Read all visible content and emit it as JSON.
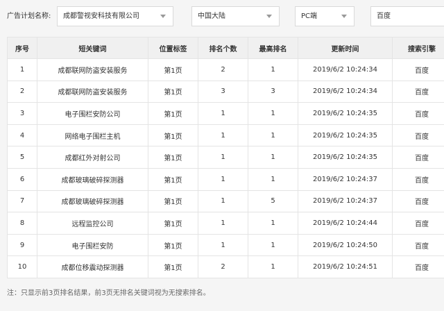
{
  "filters": {
    "label": "广告计划名称:",
    "company": "成都警视安科技有限公司",
    "region": "中国大陆",
    "device": "PC端",
    "engine": "百度"
  },
  "table": {
    "columns": [
      "序号",
      "短关键词",
      "位置标签",
      "排名个数",
      "最高排名",
      "更新时间",
      "搜索引擎"
    ],
    "rows": [
      [
        "1",
        "成都联网防盗安装服务",
        "第1页",
        "2",
        "1",
        "2019/6/2 10:24:34",
        "百度"
      ],
      [
        "2",
        "成都联网防盗安装服务",
        "第1页",
        "3",
        "3",
        "2019/6/2 10:24:34",
        "百度"
      ],
      [
        "3",
        "电子围栏安防公司",
        "第1页",
        "1",
        "1",
        "2019/6/2 10:24:35",
        "百度"
      ],
      [
        "4",
        "网络电子围栏主机",
        "第1页",
        "1",
        "1",
        "2019/6/2 10:24:35",
        "百度"
      ],
      [
        "5",
        "成都红外对射公司",
        "第1页",
        "1",
        "1",
        "2019/6/2 10:24:35",
        "百度"
      ],
      [
        "6",
        "成都玻璃破碎探测器",
        "第1页",
        "1",
        "1",
        "2019/6/2 10:24:37",
        "百度"
      ],
      [
        "7",
        "成都玻璃破碎探测器",
        "第1页",
        "1",
        "5",
        "2019/6/2 10:24:37",
        "百度"
      ],
      [
        "8",
        "远程监控公司",
        "第1页",
        "1",
        "1",
        "2019/6/2 10:24:44",
        "百度"
      ],
      [
        "9",
        "电子围栏安防",
        "第1页",
        "1",
        "1",
        "2019/6/2 10:24:50",
        "百度"
      ],
      [
        "10",
        "成都位移震动探测器",
        "第1页",
        "2",
        "1",
        "2019/6/2 10:24:51",
        "百度"
      ]
    ]
  },
  "footnote": "注：只显示前3页排名结果，前3页无排名关键词视为无搜索排名。"
}
